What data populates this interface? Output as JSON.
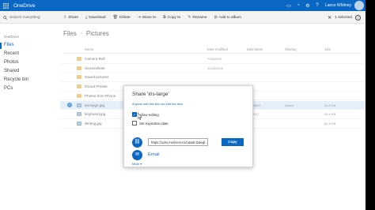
{
  "app": {
    "name": "OneDrive",
    "user": "Lance Whitney"
  },
  "toolbar": {
    "search_placeholder": "Search everything",
    "commands": [
      "Share",
      "Download",
      "Delete",
      "Move to",
      "Copy to",
      "Rename",
      "Add to album"
    ],
    "selected": "1 selected",
    "close": "✕",
    "info": "i"
  },
  "sidebar": {
    "title": "OneDrive",
    "items": [
      "Files",
      "Recent",
      "Photos",
      "Shared",
      "Recycle bin",
      "PCs"
    ]
  },
  "breadcrumb": {
    "root": "Files",
    "sep": "›",
    "current": "Pictures"
  },
  "columns": {
    "name": "Name",
    "modified": "Date modified",
    "taken": "Date taken",
    "sharing": "Sharing",
    "size": "Size"
  },
  "rows": [
    {
      "type": "folder",
      "name": "Camera Roll",
      "modified": "7/18/2016",
      "taken": "",
      "sharing": "",
      "size": ""
    },
    {
      "type": "folder",
      "name": "Screenshots",
      "modified": "11/18/2016",
      "taken": "",
      "sharing": "",
      "size": ""
    },
    {
      "type": "folder",
      "name": "Saved pictures",
      "modified": "",
      "taken": "",
      "sharing": "",
      "size": ""
    },
    {
      "type": "folder",
      "name": "iCloud Photos",
      "modified": "",
      "taken": "",
      "sharing": "",
      "size": ""
    },
    {
      "type": "folder",
      "name": "Photos from Phone",
      "modified": "",
      "taken": "",
      "sharing": "",
      "size": ""
    },
    {
      "type": "image",
      "name": "iris-large.jpg",
      "modified": "",
      "taken": "1/25/2007",
      "sharing": "Owner",
      "size": "42.6 KB",
      "selected": true
    },
    {
      "type": "image",
      "name": "keyboard.jpg",
      "modified": "",
      "taken": "2/4/2017",
      "sharing": "",
      "size": "32.4 KB"
    },
    {
      "type": "image",
      "name": "Writing.jpg",
      "modified": "",
      "taken": "",
      "sharing": "",
      "size": "62.4 KB"
    }
  ],
  "share_dialog": {
    "title": "Share 'iris-large'",
    "access": "Anyone with this link can edit this item.",
    "allow_editing": "Allow editing",
    "allow_editing_checked": true,
    "expiration": "Set expiration date",
    "expiration_checked": false,
    "link": "https://1drv.ms/i/s!Am1Gaa8t-Zalegf…",
    "copy": "Copy",
    "email": "Email",
    "more": "More"
  },
  "colors": {
    "accent": "#0a68c4"
  }
}
